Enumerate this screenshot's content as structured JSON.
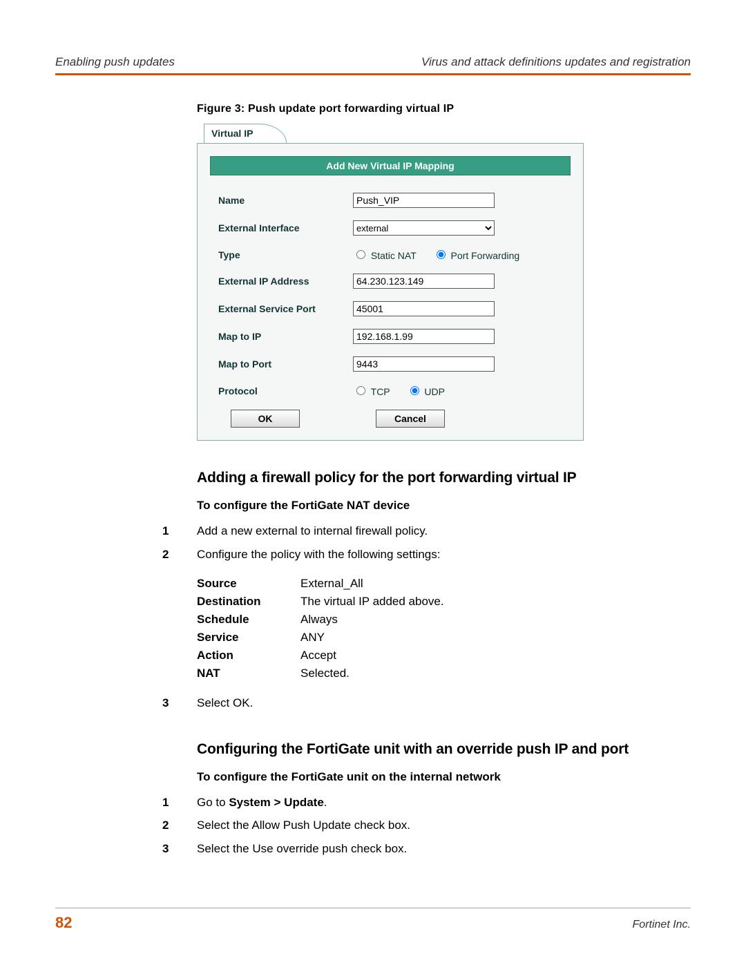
{
  "header": {
    "left": "Enabling push updates",
    "right": "Virus and attack definitions updates and registration"
  },
  "figure_caption": "Figure 3:   Push update port forwarding virtual IP",
  "virtual_ip": {
    "tab_label": "Virtual IP",
    "dialog_title": "Add New Virtual IP Mapping",
    "labels": {
      "name": "Name",
      "ext_iface": "External Interface",
      "type": "Type",
      "ext_ip": "External IP Address",
      "ext_port": "External Service Port",
      "map_ip": "Map to IP",
      "map_port": "Map to Port",
      "protocol": "Protocol"
    },
    "values": {
      "name": "Push_VIP",
      "ext_iface": "external",
      "ext_ip": "64.230.123.149",
      "ext_port": "45001",
      "map_ip": "192.168.1.99",
      "map_port": "9443"
    },
    "type_options": {
      "static_nat": "Static NAT",
      "port_forwarding": "Port Forwarding"
    },
    "protocol_options": {
      "tcp": "TCP",
      "udp": "UDP"
    },
    "buttons": {
      "ok": "OK",
      "cancel": "Cancel"
    }
  },
  "section1": {
    "heading": "Adding a firewall policy for the port forwarding virtual IP",
    "subheading": "To configure the FortiGate NAT device",
    "step1": "Add a new external to internal firewall policy.",
    "step2": "Configure the policy with the following settings:",
    "settings": {
      "source_k": "Source",
      "source_v": "External_All",
      "dest_k": "Destination",
      "dest_v": "The virtual IP added above.",
      "sched_k": "Schedule",
      "sched_v": "Always",
      "service_k": "Service",
      "service_v": "ANY",
      "action_k": "Action",
      "action_v": "Accept",
      "nat_k": "NAT",
      "nat_v": "Selected."
    },
    "step3": "Select OK."
  },
  "section2": {
    "heading": "Configuring the FortiGate unit with an override push IP and port",
    "subheading": "To configure the FortiGate unit on the internal network",
    "step1_prefix": "Go to ",
    "step1_bold": "System > Update",
    "step1_suffix": ".",
    "step2": "Select the Allow Push Update check box.",
    "step3": "Select the Use override push check box."
  },
  "footer": {
    "page": "82",
    "company": "Fortinet Inc."
  }
}
